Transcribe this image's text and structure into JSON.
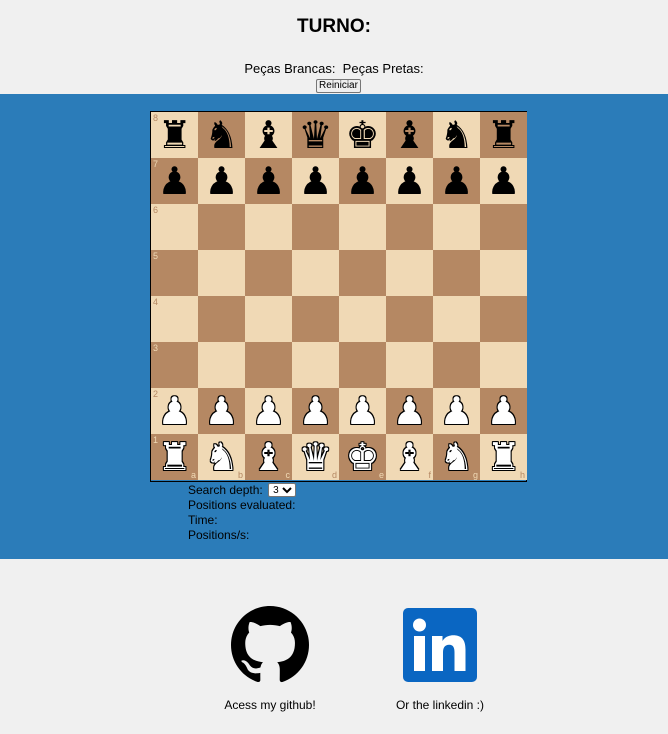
{
  "header": {
    "turn_label": "TURNO:",
    "white_label": "Peças Brancas:",
    "black_label": "Peças Pretas:",
    "reset_label": "Reiniciar"
  },
  "board": {
    "ranks": [
      "8",
      "7",
      "6",
      "5",
      "4",
      "3",
      "2",
      "1"
    ],
    "files": [
      "a",
      "b",
      "c",
      "d",
      "e",
      "f",
      "g",
      "h"
    ],
    "position": [
      [
        "bR",
        "bN",
        "bB",
        "bQ",
        "bK",
        "bB",
        "bN",
        "bR"
      ],
      [
        "bP",
        "bP",
        "bP",
        "bP",
        "bP",
        "bP",
        "bP",
        "bP"
      ],
      [
        "",
        "",
        "",
        "",
        "",
        "",
        "",
        ""
      ],
      [
        "",
        "",
        "",
        "",
        "",
        "",
        "",
        ""
      ],
      [
        "",
        "",
        "",
        "",
        "",
        "",
        "",
        ""
      ],
      [
        "",
        "",
        "",
        "",
        "",
        "",
        "",
        ""
      ],
      [
        "wP",
        "wP",
        "wP",
        "wP",
        "wP",
        "wP",
        "wP",
        "wP"
      ],
      [
        "wR",
        "wN",
        "wB",
        "wQ",
        "wK",
        "wB",
        "wN",
        "wR"
      ]
    ],
    "light_color": "#f0d9b5",
    "dark_color": "#b58863"
  },
  "stats": {
    "depth_label": "Search depth:",
    "depth_value": "3",
    "positions_label": "Positions evaluated:",
    "time_label": "Time:",
    "rate_label": "Positions/s:"
  },
  "links": {
    "github_caption": "Acess my github!",
    "github_icon": "github-icon",
    "linkedin_caption": "Or the linkedin :)",
    "linkedin_icon": "linkedin-icon"
  },
  "colors": {
    "band": "#2b7cb9",
    "page": "#f0f0f0",
    "linkedin": "#0a66c2"
  }
}
